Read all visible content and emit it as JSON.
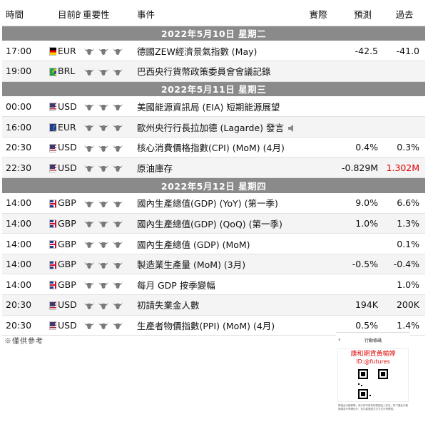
{
  "headers": {
    "time": "時間",
    "currency": "目前的",
    "importance": "重要性",
    "event": "事件",
    "actual": "實際",
    "forecast": "預測",
    "previous": "過去"
  },
  "days": [
    {
      "label": "2022年5月10日 星期二",
      "events": [
        {
          "time": "17:00",
          "flag": "de",
          "currency": "EUR",
          "event": "德國ZEW經濟景氣指數 (May)",
          "actual": "",
          "forecast": "-42.5",
          "previous": "-41.0"
        },
        {
          "time": "19:00",
          "flag": "br",
          "currency": "BRL",
          "event": "巴西央行貨幣政策委員會會議記錄",
          "actual": "",
          "forecast": "",
          "previous": ""
        }
      ]
    },
    {
      "label": "2022年5月11日 星期三",
      "events": [
        {
          "time": "00:00",
          "flag": "us",
          "currency": "USD",
          "event": "美國能源資訊局 (EIA) 短期能源展望",
          "actual": "",
          "forecast": "",
          "previous": ""
        },
        {
          "time": "16:00",
          "flag": "eu",
          "currency": "EUR",
          "event": "歐州央行行長拉加德 (Lagarde) 發言",
          "speech": true,
          "actual": "",
          "forecast": "",
          "previous": ""
        },
        {
          "time": "20:30",
          "flag": "us",
          "currency": "USD",
          "event": "核心消費價格指數(CPI) (MoM) (4月)",
          "actual": "",
          "forecast": "0.4%",
          "previous": "0.3%"
        },
        {
          "time": "22:30",
          "flag": "us",
          "currency": "USD",
          "event": "原油庫存",
          "actual": "",
          "forecast": "-0.829M",
          "previous": "1.302M",
          "previous_color": "red"
        }
      ]
    },
    {
      "label": "2022年5月12日 星期四",
      "events": [
        {
          "time": "14:00",
          "flag": "gb",
          "currency": "GBP",
          "event": "國內生產總值(GDP) (YoY) (第一季)",
          "actual": "",
          "forecast": "9.0%",
          "previous": "6.6%"
        },
        {
          "time": "14:00",
          "flag": "gb",
          "currency": "GBP",
          "event": "國內生產總值(GDP) (QoQ) (第一季)",
          "actual": "",
          "forecast": "1.0%",
          "previous": "1.3%"
        },
        {
          "time": "14:00",
          "flag": "gb",
          "currency": "GBP",
          "event": "國內生產總值 (GDP) (MoM)",
          "actual": "",
          "forecast": "",
          "previous": "0.1%"
        },
        {
          "time": "14:00",
          "flag": "gb",
          "currency": "GBP",
          "event": "製造業生產量 (MoM) (3月)",
          "actual": "",
          "forecast": "-0.5%",
          "previous": "-0.4%"
        },
        {
          "time": "14:00",
          "flag": "gb",
          "currency": "GBP",
          "event": "每月 GDP 按季變幅",
          "actual": "",
          "forecast": "",
          "previous": "1.0%"
        },
        {
          "time": "20:30",
          "flag": "us",
          "currency": "USD",
          "event": "初請失業金人數",
          "actual": "",
          "forecast": "194K",
          "previous": "200K"
        },
        {
          "time": "20:30",
          "flag": "us",
          "currency": "USD",
          "event": "生產者物價指數(PPI) (MoM) (4月)",
          "actual": "",
          "forecast": "0.5%",
          "previous": "1.4%"
        }
      ]
    }
  ],
  "importance_bulls": 3,
  "note": "※僅供參考",
  "promo": {
    "back": "‹",
    "title": "行動條碼",
    "name": "康和期貨黃榆婷",
    "id": "ID:@futures",
    "footer": "掃描此行動條碼，用戶即可將您的帳號加入好友，除下載此行動條碼或分享網址外，您亦能透過文字方式分享帳號。"
  },
  "colors": {
    "day_header_bg": "#8a8a8a",
    "row_alt_bg": "#f4f4f4",
    "highlight_red": "#e00000",
    "bull_icon": "#7a7a7a"
  }
}
